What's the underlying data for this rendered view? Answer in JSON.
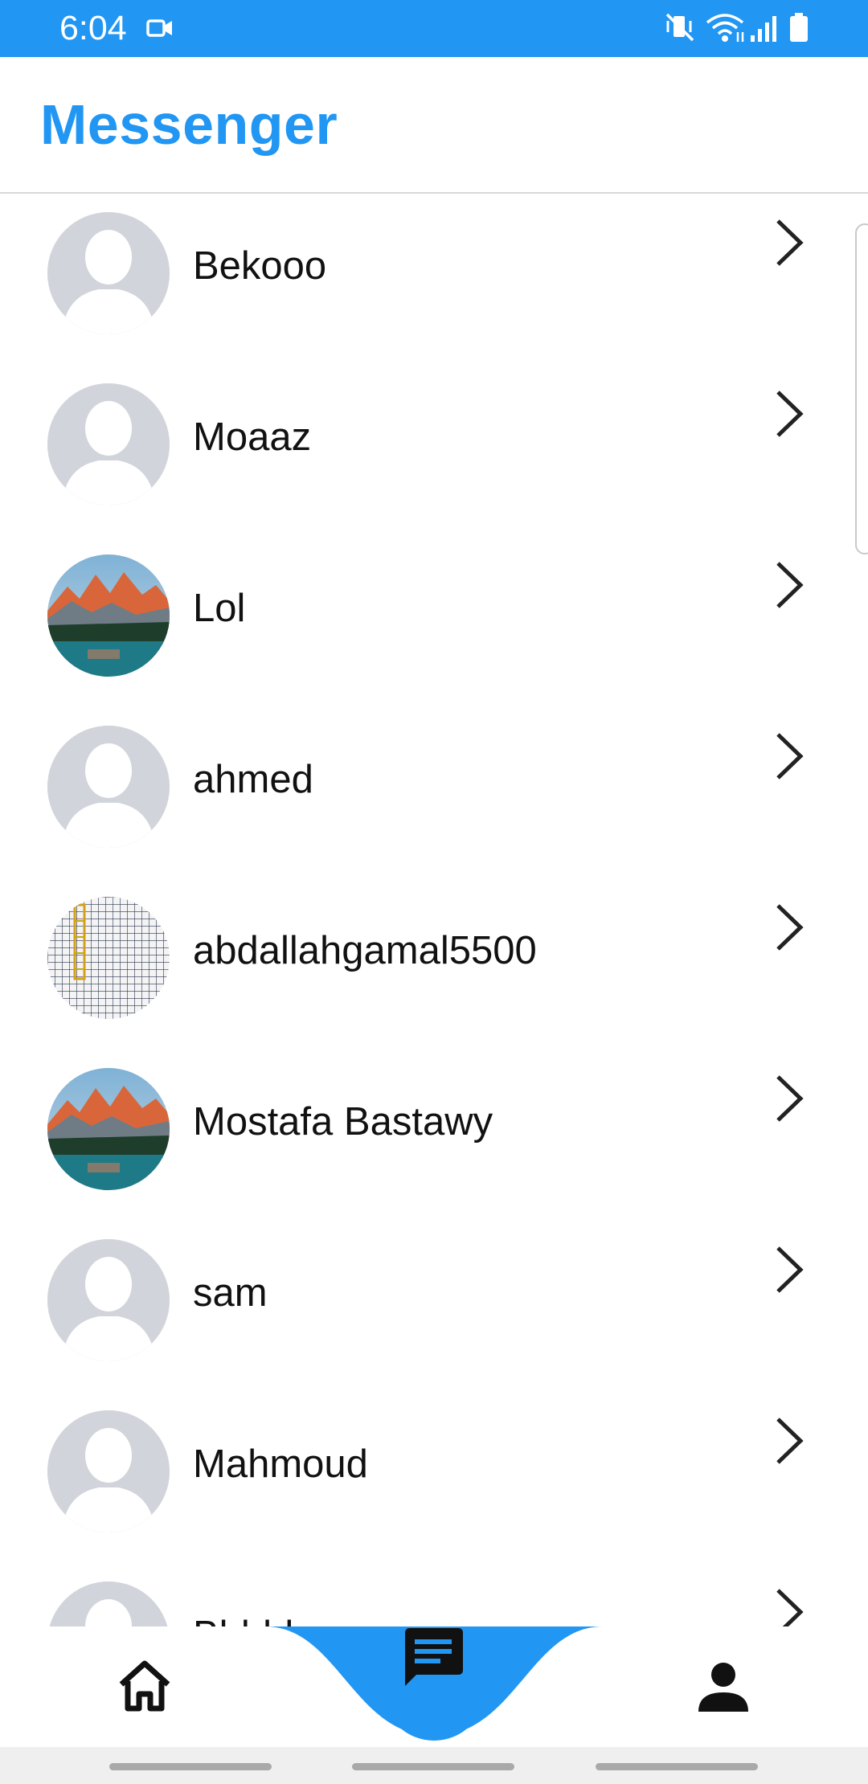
{
  "status_bar": {
    "time": "6:04",
    "icons": [
      "video-camera-icon",
      "vibrate-mute-icon",
      "wifi-icon",
      "signal-icon",
      "battery-icon"
    ],
    "background": "#2196F3"
  },
  "app_bar": {
    "title": "Messenger",
    "title_color": "#2196F3"
  },
  "contacts": [
    {
      "name": "Bekooo",
      "avatar": "default-avatar"
    },
    {
      "name": "Moaaz",
      "avatar": "default-avatar"
    },
    {
      "name": "Lol",
      "avatar": "mountain-lake-photo"
    },
    {
      "name": "ahmed",
      "avatar": "default-avatar"
    },
    {
      "name": "abdallahgamal5500",
      "avatar": "grid-pattern-photo"
    },
    {
      "name": "Mostafa Bastawy",
      "avatar": "mountain-lake-photo"
    },
    {
      "name": "sam",
      "avatar": "default-avatar"
    },
    {
      "name": "Mahmoud",
      "avatar": "default-avatar"
    },
    {
      "name": "Bbbbb",
      "avatar": "default-avatar"
    }
  ],
  "bottom_nav": {
    "items": [
      {
        "icon": "home-icon",
        "active": false
      },
      {
        "icon": "chat-icon",
        "active": true
      },
      {
        "icon": "person-icon",
        "active": false
      }
    ],
    "accent": "#2196F3"
  }
}
